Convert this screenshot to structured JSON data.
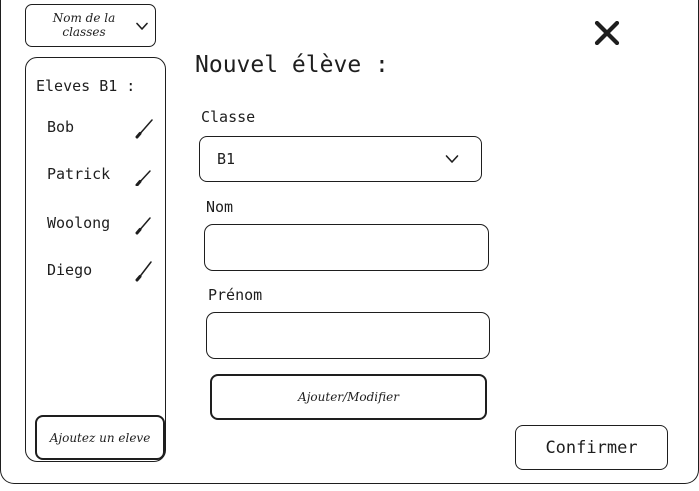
{
  "class_select": {
    "label": "Nom de la classes",
    "icon": "chevron-down-icon"
  },
  "sidebar": {
    "title": "Eleves B1 :",
    "students": [
      {
        "name": "Bob"
      },
      {
        "name": "Patrick"
      },
      {
        "name": "Woolong"
      },
      {
        "name": "Diego"
      }
    ],
    "add_label": "Ajoutez un eleve",
    "edit_icon": "pencil-icon"
  },
  "close_icon": "close-icon",
  "form": {
    "title": "Nouvel élève :",
    "class_label": "Classe",
    "class_value": "B1",
    "nom_label": "Nom",
    "nom_value": "",
    "prenom_label": "Prénom",
    "prenom_value": "",
    "add_modify_label": "Ajouter/Modifier",
    "confirm_label": "Confirmer"
  }
}
